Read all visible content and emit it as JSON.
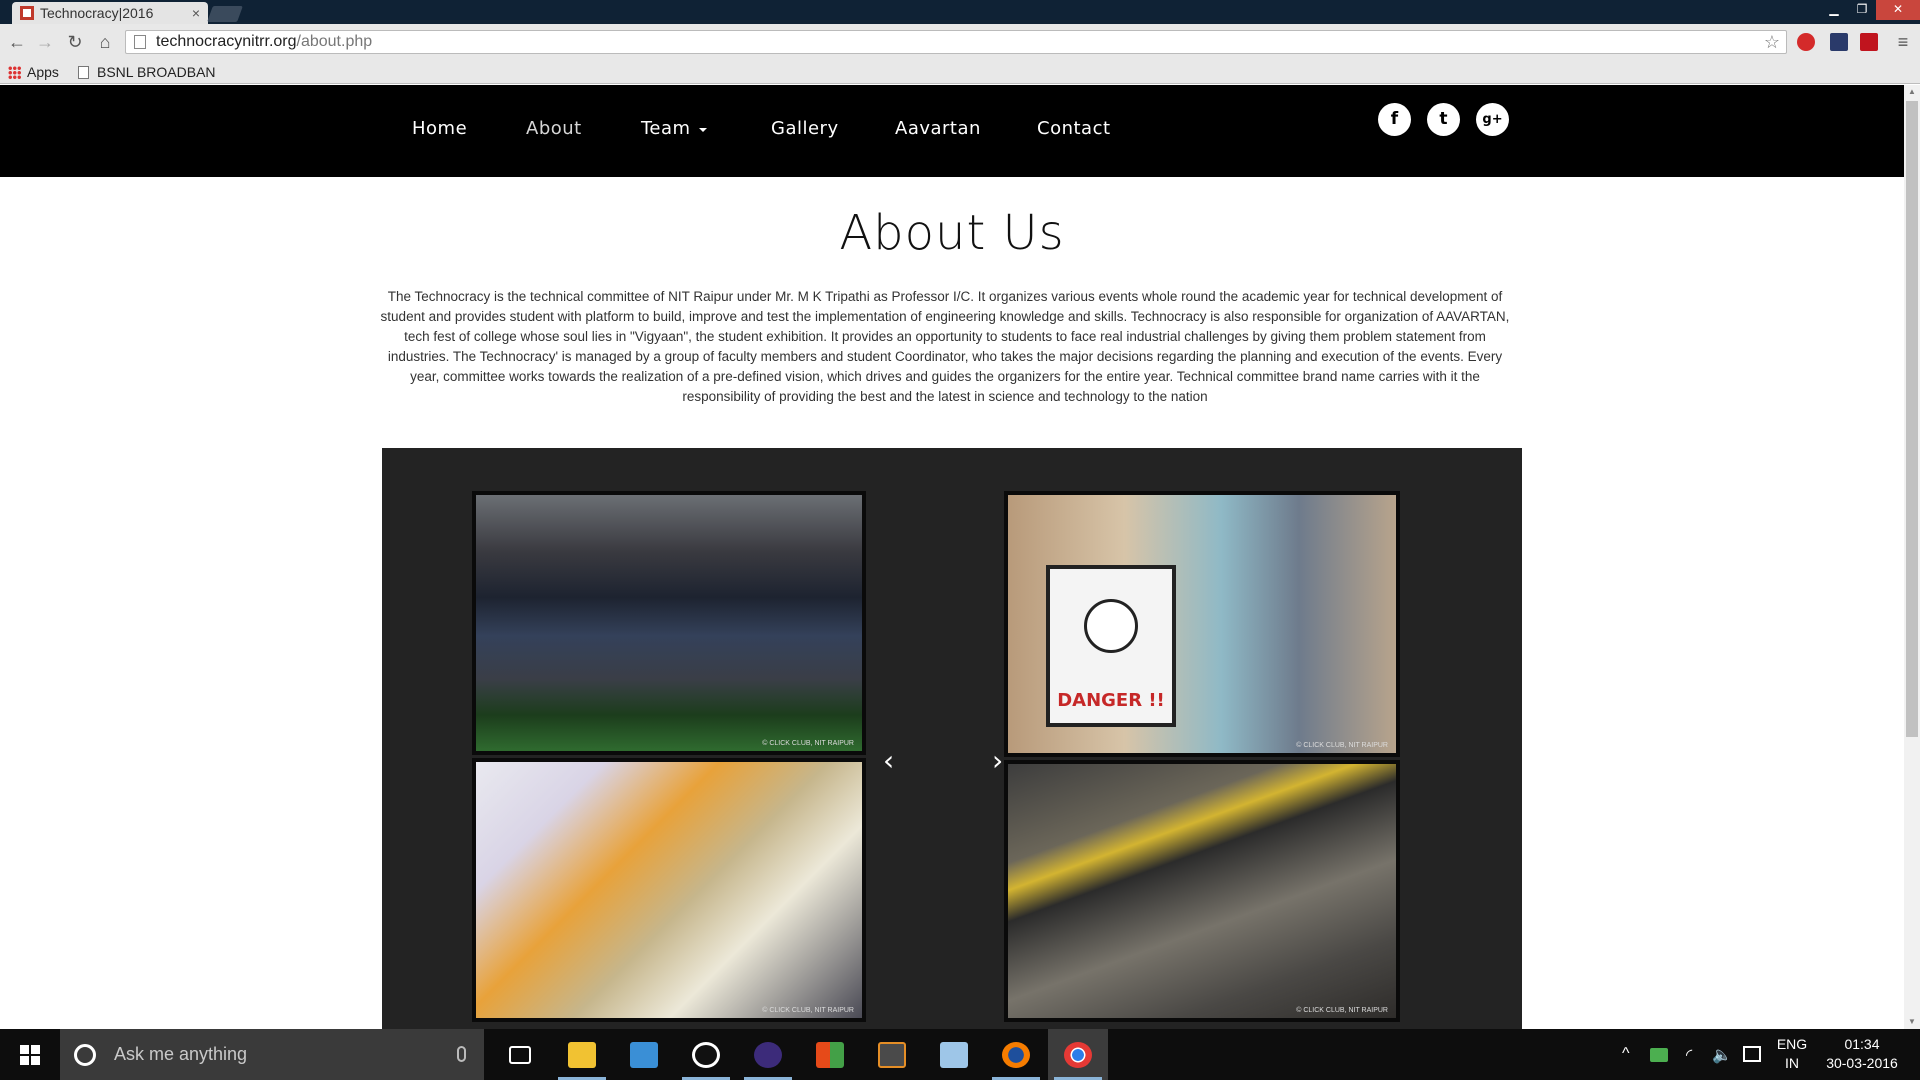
{
  "browser": {
    "tab_title": "Technocracy|2016",
    "tab_close": "×",
    "url_domain": "technocracynitrr.org",
    "url_path": "/about.php",
    "bookmarks": [
      {
        "label": "Apps",
        "icon": "apps-grid-icon"
      },
      {
        "label": "BSNL BROADBAN",
        "icon": "page-icon"
      }
    ],
    "window_controls": [
      "▁",
      "❐",
      "✕"
    ]
  },
  "site": {
    "nav": {
      "items": [
        "Home",
        "About",
        "Team",
        "Gallery",
        "Aavartan",
        "Contact"
      ],
      "social": [
        {
          "icon": "facebook-icon",
          "glyph": "f"
        },
        {
          "icon": "twitter-icon",
          "glyph": "t"
        },
        {
          "icon": "google-plus-icon",
          "glyph": "g+"
        }
      ]
    },
    "about": {
      "title": "About Us",
      "text": "The Technocracy is the technical committee of NIT Raipur under Mr. M K Tripathi as Professor I/C. It organizes various events whole round the academic year for technical development of student and provides student with platform to build, improve and test the implementation of engineering knowledge and skills. Technocracy is also responsible for organization of AAVARTAN, tech fest of college whose soul lies in \"Vigyaan\", the student exhibition. It provides an opportunity to students to face real industrial challenges by giving them problem statement from industries. The Technocracy' is managed by a group of faculty members and student Coordinator, who takes the major decisions regarding the planning and execution of the events. Every year, committee works towards the realization of a pre-defined vision, which drives and guides the organizers for the entire year. Technical committee brand name carries with it the responsibility of providing the best and the latest in science and technology to the nation"
    },
    "gallery": {
      "prev": "‹",
      "next": "›",
      "photos": [
        {
          "credit": "© CLICK CLUB, NIT RAIPUR"
        },
        {
          "credit": "© CLICK CLUB, NIT RAIPUR"
        },
        {
          "credit": "© CLICK CLUB, NIT RAIPUR"
        },
        {
          "credit": "© CLICK CLUB, NIT RAIPUR"
        }
      ],
      "sign_text": "DANGER !!"
    }
  },
  "taskbar": {
    "search_placeholder": "Ask me anything",
    "lang_line1": "ENG",
    "lang_line2": "IN",
    "time": "01:34",
    "date": "30-03-2016"
  }
}
